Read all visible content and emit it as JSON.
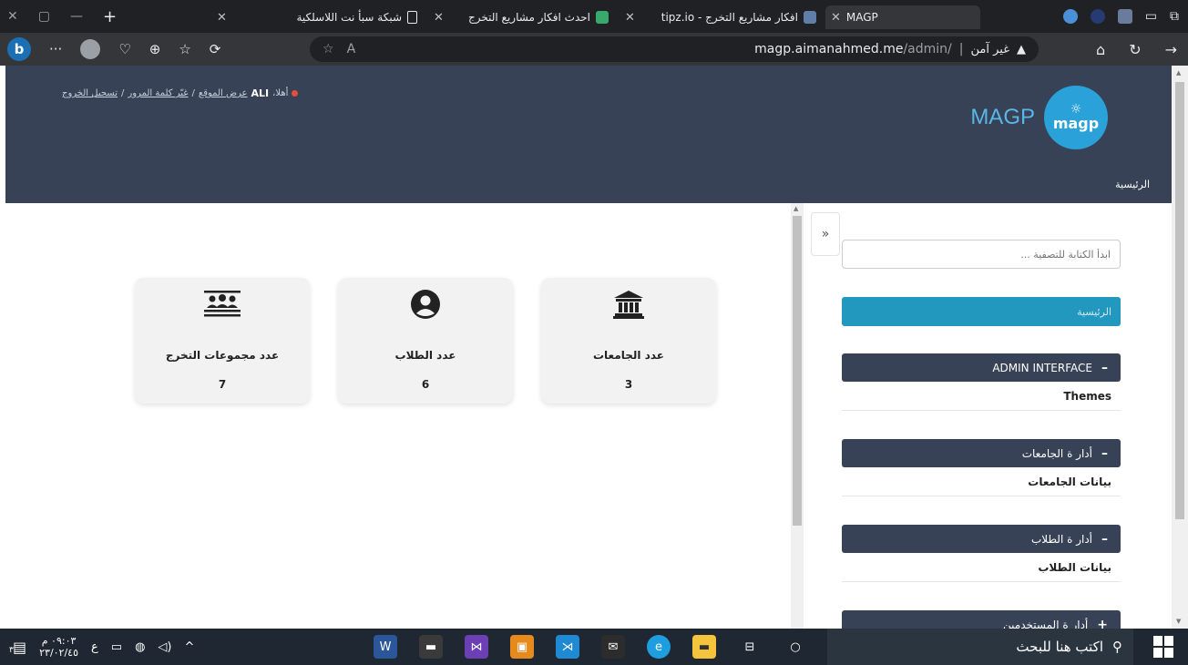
{
  "browser": {
    "tabs": [
      {
        "title": "MAGP",
        "active": true
      },
      {
        "title": "افكار مشاريع التخرج - tipz.io",
        "active": false
      },
      {
        "title": "احدث افكار مشاريع التخرج",
        "active": false
      },
      {
        "title": "شبكة سبأ نت اللاسلكية",
        "active": false
      }
    ],
    "url_host": "magp.aimanahmed.me",
    "url_path": "/admin/",
    "security_label": "غير آمن",
    "reader_label": "A̵"
  },
  "header": {
    "brand": "MAGP",
    "logo_text": "magp",
    "welcome": "أهلا،",
    "username": "ALI",
    "links": [
      "عرض الموقع",
      "غيّر كلمة المرور",
      "تسجيل الخروج"
    ],
    "breadcrumb": "الرئيسية"
  },
  "cards": [
    {
      "icon": "university-icon",
      "label": "عدد الجامعات",
      "value": "3"
    },
    {
      "icon": "user-icon",
      "label": "عدد الطلاب",
      "value": "6"
    },
    {
      "icon": "users-icon",
      "label": "عدد مجموعات التخرج",
      "value": "7"
    }
  ],
  "sidebar": {
    "toggle": "»",
    "filter_placeholder": "ابدأ الكتابة للتصفية ...",
    "home_link": "الرئيسية",
    "modules": [
      {
        "title": "ADMIN INTERFACE",
        "sign": "–",
        "items": [
          "Themes"
        ]
      },
      {
        "title": "أدار ة الجامعات",
        "sign": "–",
        "items": [
          "بيانات الجامعات"
        ]
      },
      {
        "title": "أدار ة الطلاب",
        "sign": "–",
        "items": [
          "بيانات الطلاب"
        ]
      },
      {
        "title": "أدار ة المستخدمين",
        "sign": "+",
        "items": []
      }
    ]
  },
  "taskbar": {
    "search_placeholder": "اكتب هنا للبحث",
    "time": "٠٩:٠٣ م",
    "date": "٢٣/٠٢/٤٥",
    "lang": "ع",
    "notif_count": "٣"
  },
  "colors": {
    "header_bg": "#374256",
    "accent": "#2398bf",
    "brand_blue": "#5bb6e8"
  }
}
